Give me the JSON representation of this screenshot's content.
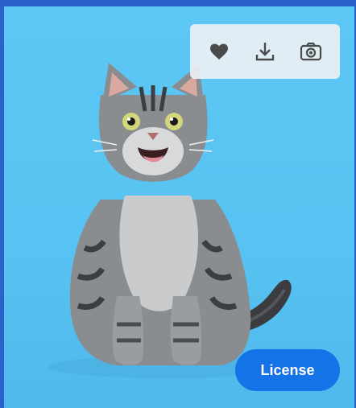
{
  "image": {
    "subject": "cat-photo",
    "background_color": "#5cc6f4"
  },
  "actions": {
    "like_icon": "heart-icon",
    "download_icon": "download-icon",
    "similar_icon": "camera-icon"
  },
  "license_button": {
    "label": "License",
    "color": "#1473e6"
  },
  "frame_color": "#2a62c9"
}
